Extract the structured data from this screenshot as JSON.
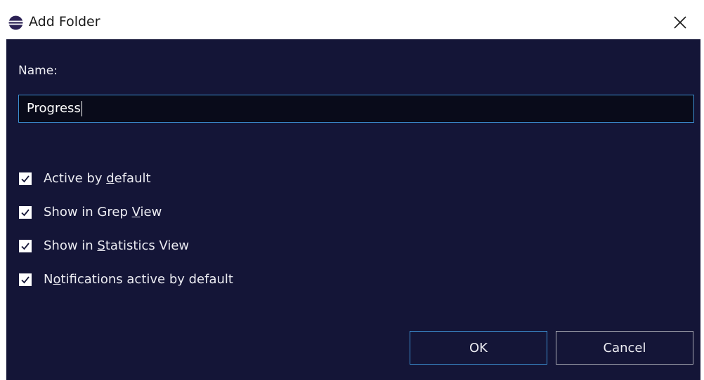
{
  "window": {
    "title": "Add Folder",
    "title_icon": "eclipse-icon",
    "close_icon": "close-icon"
  },
  "form": {
    "name_label": "Name:",
    "name_value": "Progress"
  },
  "options": [
    {
      "pre": "Active by ",
      "mnemonic": "d",
      "post": "efault",
      "checked": true
    },
    {
      "pre": "Show in Grep ",
      "mnemonic": "V",
      "post": "iew",
      "checked": true
    },
    {
      "pre": "Show in ",
      "mnemonic": "S",
      "post": "tatistics View",
      "checked": true
    },
    {
      "pre": "N",
      "mnemonic": "o",
      "post": "tifications active by default",
      "checked": true
    }
  ],
  "buttons": {
    "ok_label": "OK",
    "cancel_label": "Cancel"
  },
  "colors": {
    "dialog_background": "#141537",
    "input_background": "#090b1a",
    "focus_border": "#3c8fd2",
    "text": "#ececf2"
  }
}
